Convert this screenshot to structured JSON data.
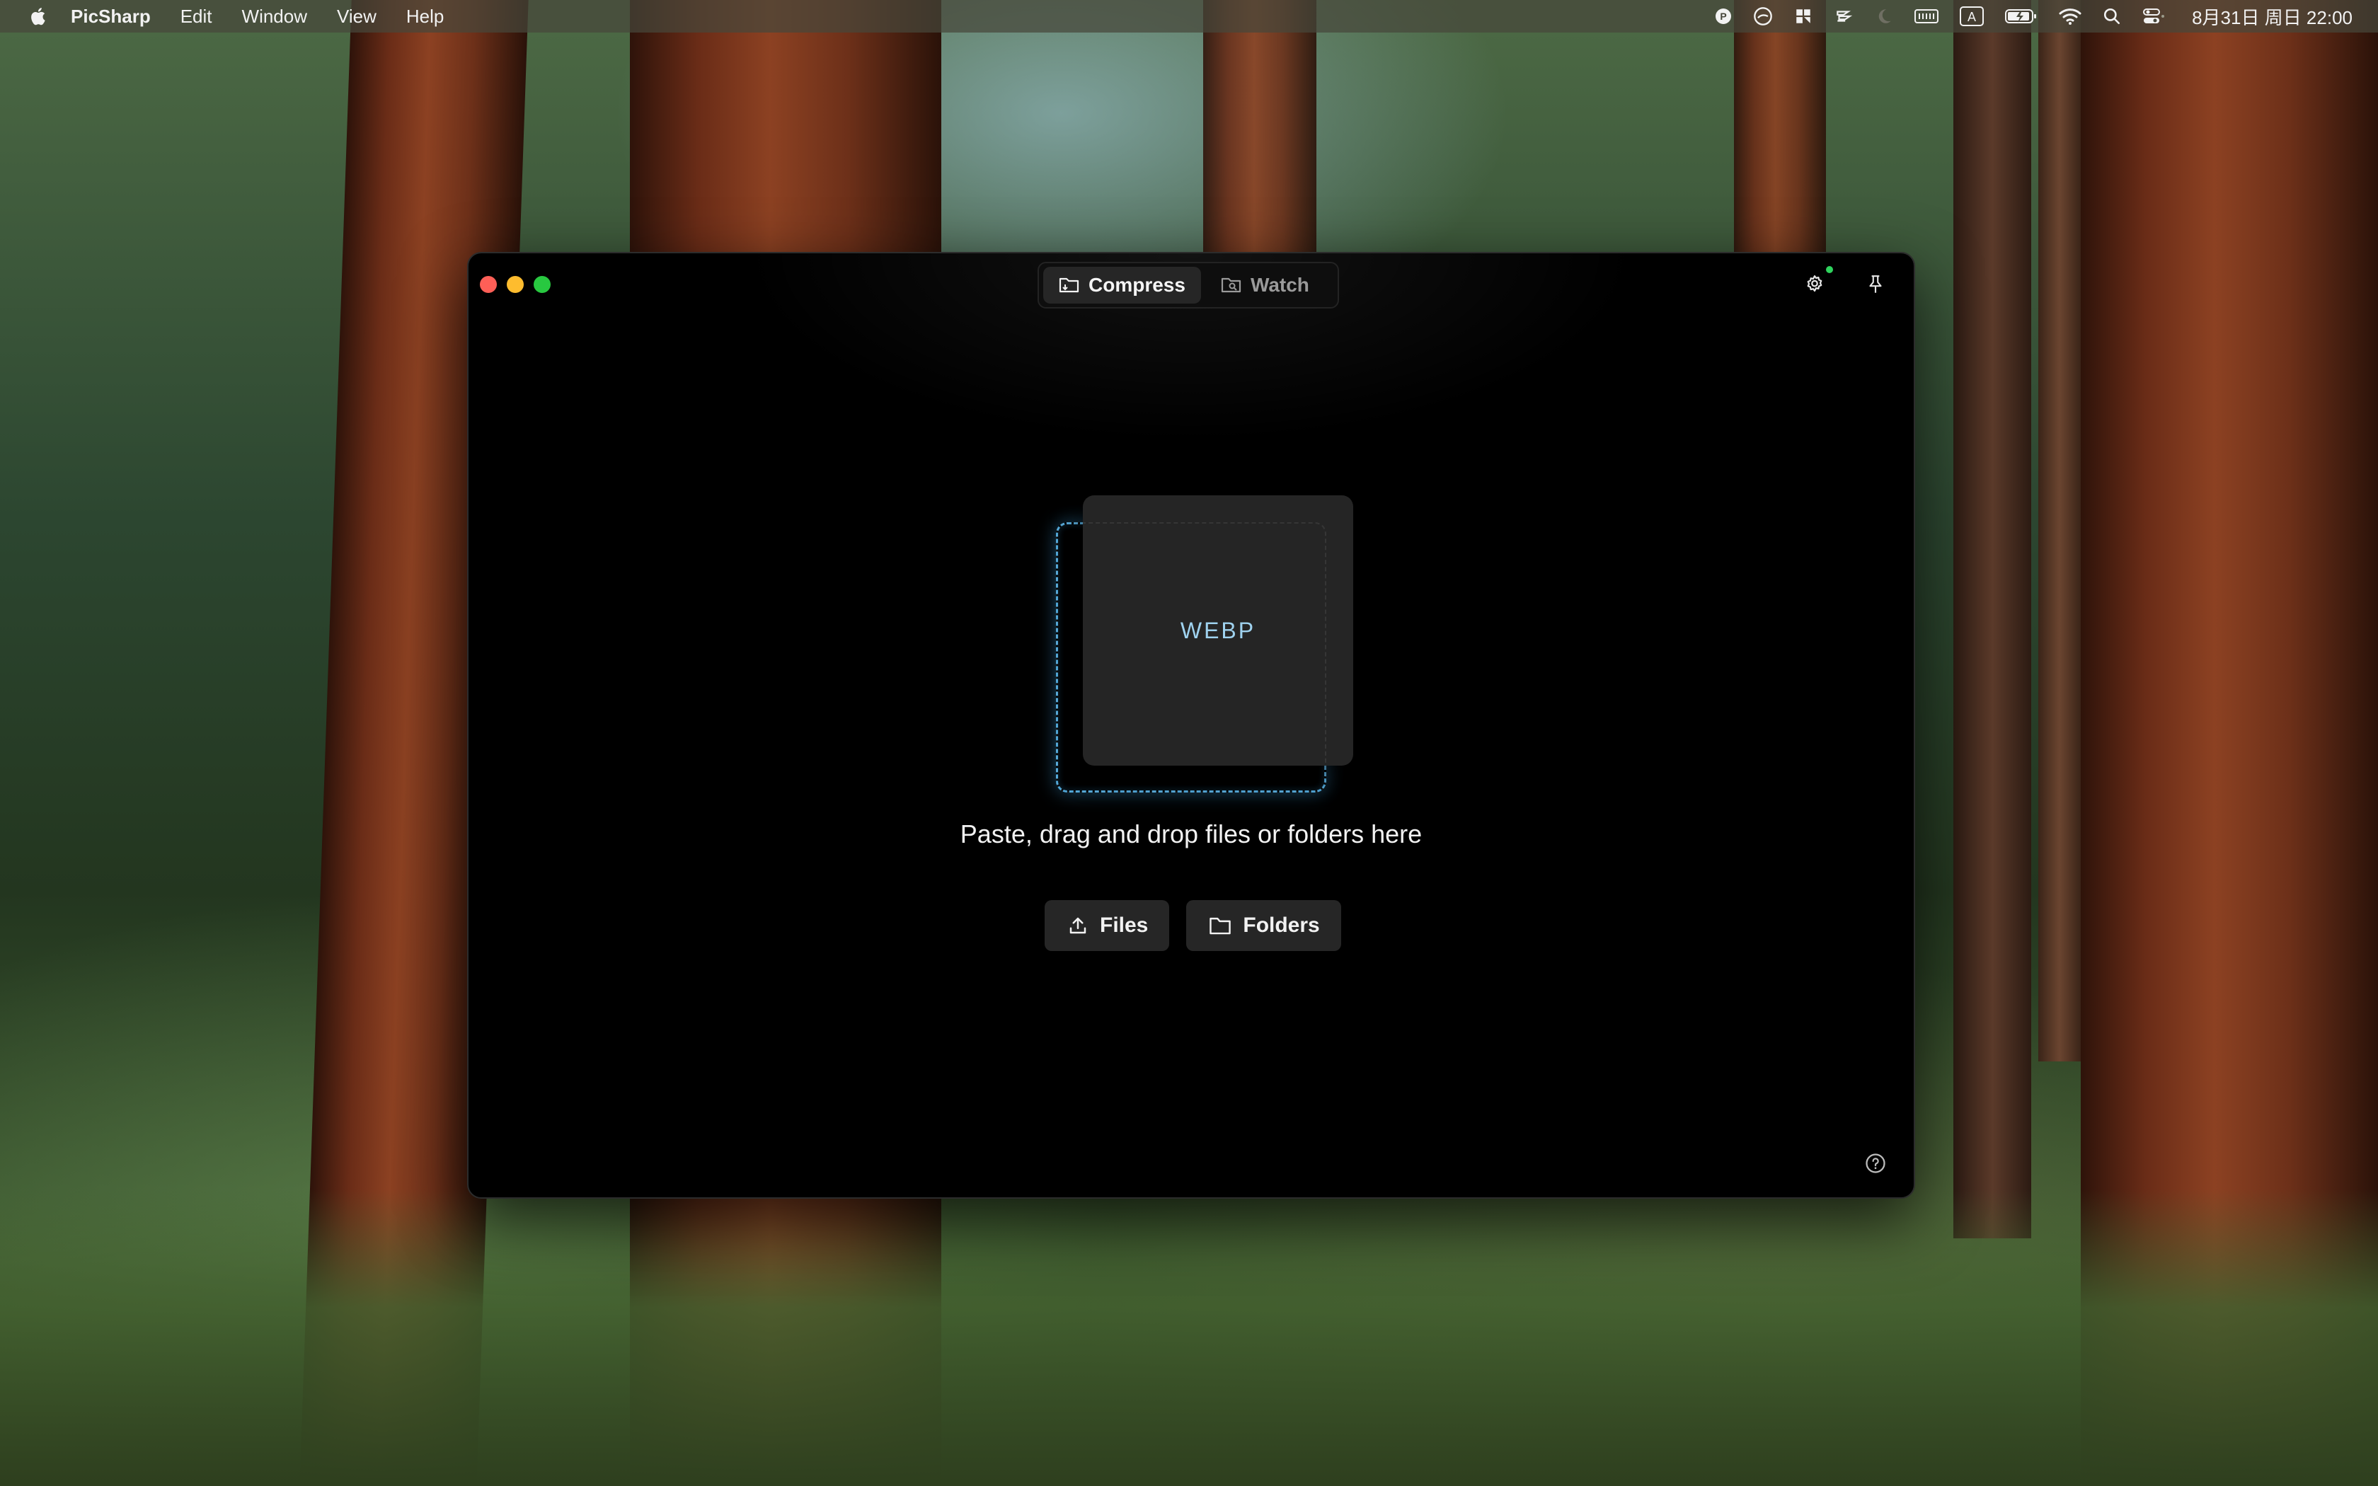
{
  "menubar": {
    "app_name": "PicSharp",
    "items": [
      "Edit",
      "Window",
      "View",
      "Help"
    ],
    "clock": "8月31日 周日  22:00"
  },
  "window": {
    "tabs": [
      {
        "label": "Compress",
        "icon": "folder-compress-icon",
        "active": true
      },
      {
        "label": "Watch",
        "icon": "folder-watch-icon",
        "active": false
      }
    ],
    "settings_badge_color": "#2fd35d"
  },
  "dropzone": {
    "format_label": "WEBP",
    "hint": "Paste, drag and drop files or folders here",
    "accent_color": "#4fa6d8"
  },
  "actions": {
    "files_label": "Files",
    "folders_label": "Folders"
  }
}
